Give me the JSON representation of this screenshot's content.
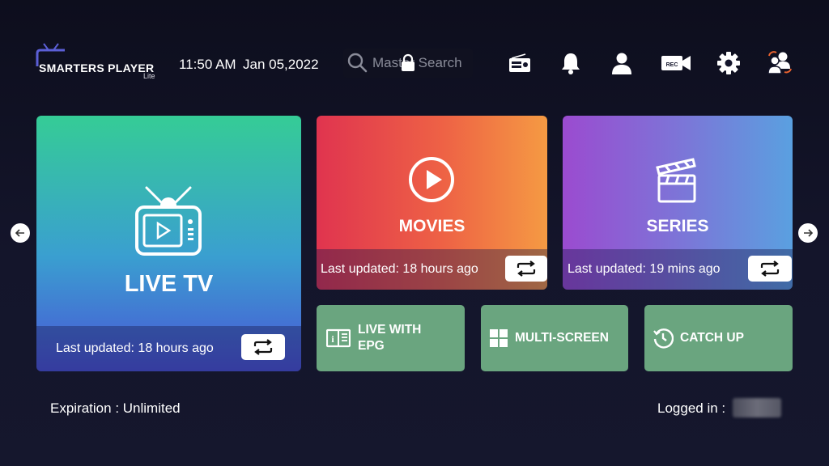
{
  "header": {
    "logo": {
      "main": "SMARTERS PLAYER",
      "sub": "Lite"
    },
    "time": "11:50 AM",
    "date": "Jan 05,2022",
    "search": {
      "placeholder": "Master Search"
    },
    "icons": [
      "radio-icon",
      "bell-icon",
      "user-icon",
      "record-icon",
      "gear-icon",
      "switch-user-icon"
    ]
  },
  "cards": {
    "live_tv": {
      "title": "LIVE TV",
      "updated": "Last updated: 18 hours ago"
    },
    "movies": {
      "title": "MOVIES",
      "updated": "Last updated: 18 hours ago"
    },
    "series": {
      "title": "SERIES",
      "updated": "Last updated: 19 mins ago"
    }
  },
  "tiles": {
    "epg": {
      "line1": "LIVE WITH",
      "line2": "EPG"
    },
    "multiscreen": {
      "label": "MULTI-SCREEN"
    },
    "catchup": {
      "label": "CATCH UP"
    }
  },
  "footer": {
    "expiration": "Expiration : Unlimited",
    "logged_in": "Logged in :"
  },
  "colors": {
    "background": "#14152b",
    "tile_green": "#6aa57f",
    "live_tv_gradient": [
      "#35cc96",
      "#3a9fd0",
      "#4a54d6"
    ],
    "movies_gradient": [
      "#e0344f",
      "#ee6245",
      "#f59a43"
    ],
    "series_gradient": [
      "#9b4bd0",
      "#7a78d8",
      "#5aa0e0"
    ]
  }
}
